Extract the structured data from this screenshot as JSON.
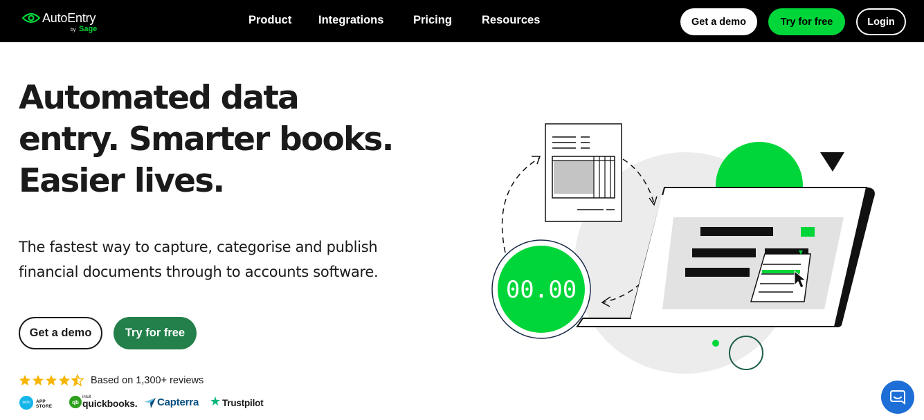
{
  "nav": {
    "logo": {
      "name": "AutoEntry",
      "by": "by",
      "sub_brand": "Sage"
    },
    "links": [
      "Product",
      "Integrations",
      "Pricing",
      "Resources"
    ],
    "get_demo_label": "Get a demo",
    "try_free_label": "Try for free",
    "login_label": "Login"
  },
  "hero": {
    "title_lines": [
      "Automated data",
      "entry. Smarter books.",
      "Easier lives."
    ],
    "subtitle_lines": [
      "The fastest way to capture, categorise and publish",
      "financial documents through to accounts software."
    ],
    "cta_demo_label": "Get a demo",
    "cta_try_label": "Try for free"
  },
  "rating": {
    "stars": 4.5,
    "star_count": 5,
    "review_text": "Based on 1,300+ reviews"
  },
  "partners": {
    "xero_mark": "xero",
    "xero_store": "APP STORE",
    "quickbooks_intuit": "intuit",
    "quickbooks": "quickbooks.",
    "capterra": "Capterra",
    "trustpilot": "Trustpilot"
  },
  "illustration": {
    "counter_text": "00.00"
  },
  "colors": {
    "accent_green": "#00d639",
    "cta_green": "#23804a",
    "nav_bg": "#000000",
    "star_gold": "#f7b500",
    "chat_blue": "#1d6ed6"
  },
  "icons": {
    "logo": "eye-logo-icon",
    "chat": "chat-bubble-icon",
    "cursor": "mouse-pointer-icon"
  }
}
